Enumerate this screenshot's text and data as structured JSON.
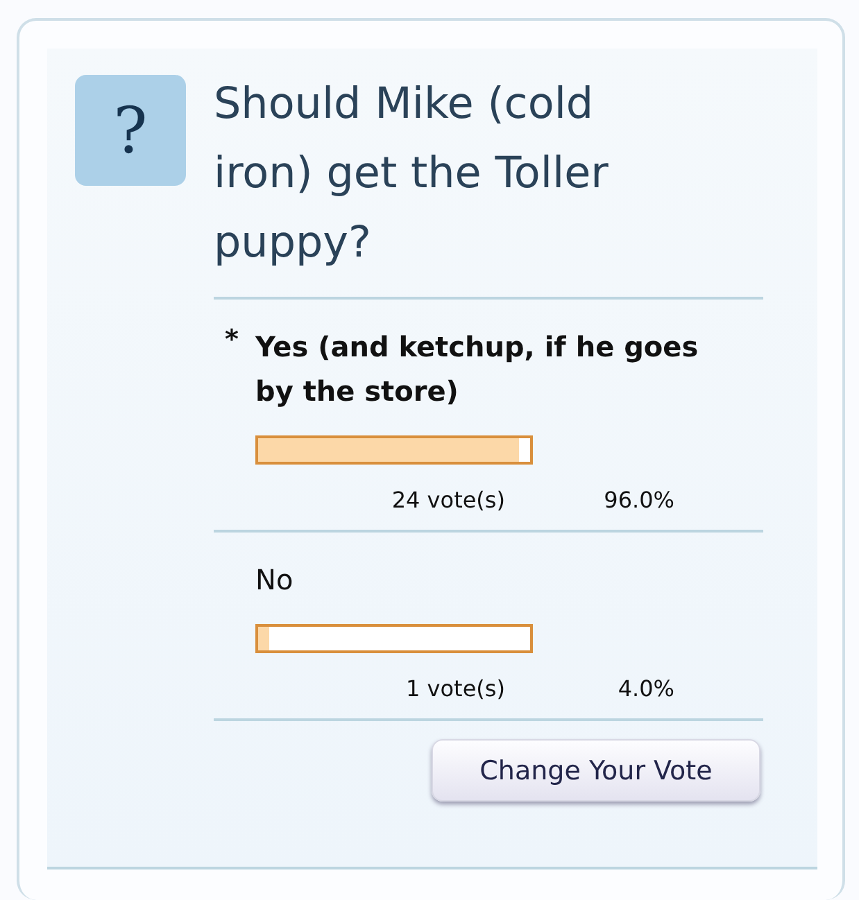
{
  "poll": {
    "icon": "?",
    "question": "Should Mike (cold iron) get the Toller puppy?",
    "voted_marker": "*",
    "options": [
      {
        "label": "Yes (and ketchup, if he goes by the store)",
        "voted": true,
        "level": 0.96,
        "votes": "24 vote(s)",
        "percent": "96.0%"
      },
      {
        "label": "No",
        "voted": false,
        "level": 0.04,
        "votes": "1 vote(s)",
        "percent": "4.0%"
      }
    ],
    "button": "Change Your Vote"
  }
}
